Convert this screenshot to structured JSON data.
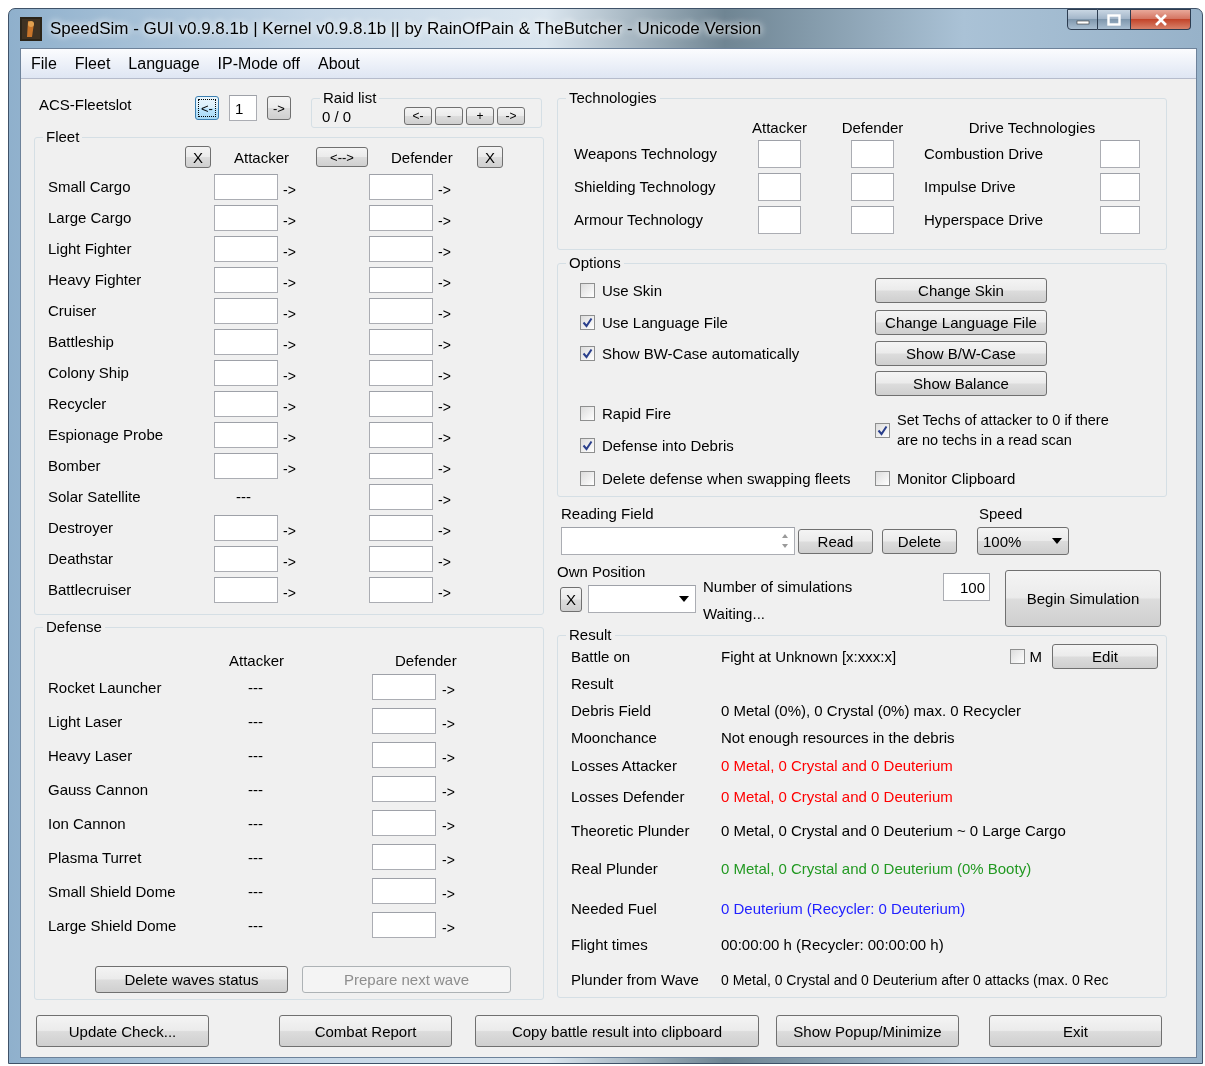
{
  "window": {
    "title": "SpeedSim - GUI v0.9.8.1b | Kernel v0.9.8.1b || by RainOfPain & TheButcher - Unicode Version"
  },
  "menu": [
    {
      "label": "File"
    },
    {
      "label": "Fleet"
    },
    {
      "label": "Language"
    },
    {
      "label": "IP-Mode off"
    },
    {
      "label": "About"
    }
  ],
  "acs_fleetslot": {
    "label": "ACS-Fleetslot",
    "prev": {
      "label": "<-",
      "focused": true
    },
    "value": "1",
    "next": {
      "label": "->",
      "focused": false
    }
  },
  "raid_list": {
    "title": "Raid list",
    "count": "0 / 0",
    "buttons": [
      "<-",
      "-",
      "+",
      "->"
    ]
  },
  "fleet": {
    "title": "Fleet",
    "clear_attacker": "X",
    "attacker": "Attacker",
    "swap": "<-->",
    "defender": "Defender",
    "clear_defender": "X",
    "ships": [
      {
        "name": "Small Cargo",
        "attacker_arrow": "->",
        "defender_arrow": "->"
      },
      {
        "name": "Large Cargo",
        "attacker_arrow": "->",
        "defender_arrow": "->"
      },
      {
        "name": "Light Fighter",
        "attacker_arrow": "->",
        "defender_arrow": "->"
      },
      {
        "name": "Heavy Fighter",
        "attacker_arrow": "->",
        "defender_arrow": "->"
      },
      {
        "name": "Cruiser",
        "attacker_arrow": "->",
        "defender_arrow": "->"
      },
      {
        "name": "Battleship",
        "attacker_arrow": "->",
        "defender_arrow": "->"
      },
      {
        "name": "Colony Ship",
        "attacker_arrow": "->",
        "defender_arrow": "->"
      },
      {
        "name": "Recycler",
        "attacker_arrow": "->",
        "defender_arrow": "->"
      },
      {
        "name": "Espionage Probe",
        "attacker_arrow": "->",
        "defender_arrow": "->"
      },
      {
        "name": "Bomber",
        "attacker_arrow": "->",
        "defender_arrow": "->"
      },
      {
        "name": "Solar Satellite",
        "attacker": "---",
        "defender_arrow": "->"
      },
      {
        "name": "Destroyer",
        "attacker_arrow": "->",
        "defender_arrow": "->"
      },
      {
        "name": "Deathstar",
        "attacker_arrow": "->",
        "defender_arrow": "->"
      },
      {
        "name": "Battlecruiser",
        "attacker_arrow": "->",
        "defender_arrow": "->"
      }
    ]
  },
  "defense": {
    "title": "Defense",
    "attacker": "Attacker",
    "defender": "Defender",
    "items": [
      {
        "name": "Rocket Launcher",
        "attacker": "---",
        "defender_arrow": "->"
      },
      {
        "name": "Light Laser",
        "attacker": "---",
        "defender_arrow": "->"
      },
      {
        "name": "Heavy Laser",
        "attacker": "---",
        "defender_arrow": "->"
      },
      {
        "name": "Gauss Cannon",
        "attacker": "---",
        "defender_arrow": "->"
      },
      {
        "name": "Ion Cannon",
        "attacker": "---",
        "defender_arrow": "->"
      },
      {
        "name": "Plasma Turret",
        "attacker": "---",
        "defender_arrow": "->"
      },
      {
        "name": "Small Shield Dome",
        "attacker": "---",
        "defender_arrow": "->"
      },
      {
        "name": "Large Shield Dome",
        "attacker": "---",
        "defender_arrow": "->"
      }
    ],
    "buttons": [
      {
        "label": "Delete waves status",
        "disabled": false
      },
      {
        "label": "Prepare next wave",
        "disabled": true
      }
    ]
  },
  "technologies": {
    "title": "Technologies",
    "attacker": "Attacker",
    "defender": "Defender",
    "drive_header": "Drive Technologies",
    "rows": [
      {
        "name": "Weapons Technology",
        "drive": "Combustion Drive"
      },
      {
        "name": "Shielding Technology",
        "drive": "Impulse Drive"
      },
      {
        "name": "Armour Technology",
        "drive": "Hyperspace Drive"
      }
    ]
  },
  "options": {
    "title": "Options",
    "items": [
      {
        "kind": "checkbox",
        "label": "Use Skin",
        "checked": false
      },
      {
        "kind": "button",
        "label": "Change Skin"
      },
      {
        "kind": "checkbox",
        "label": "Use Language File",
        "checked": true
      },
      {
        "kind": "button",
        "label": "Change Language File"
      },
      {
        "kind": "checkbox",
        "label": "Show BW-Case automatically",
        "checked": true
      },
      {
        "kind": "button",
        "label": "Show B/W-Case"
      },
      {
        "kind": "button",
        "label": "Show Balance"
      },
      {
        "kind": "checkbox",
        "label": "Rapid Fire",
        "checked": false
      },
      {
        "kind": "checkbox",
        "label": "Set Techs of attacker to 0 if there are no techs in a read scan",
        "checked": true
      },
      {
        "kind": "checkbox",
        "label": "Defense into Debris",
        "checked": true
      },
      {
        "kind": "checkbox",
        "label": "Delete defense when swapping fleets",
        "checked": false
      },
      {
        "kind": "checkbox",
        "label": "Monitor Clipboard",
        "checked": false
      }
    ]
  },
  "reading": {
    "label": "Reading Field",
    "read": "Read",
    "delete": "Delete",
    "speed_label": "Speed",
    "speed": "100%"
  },
  "simulation": {
    "own_position": "Own Position",
    "clear": "X",
    "count_label": "Number of simulations",
    "count": "100",
    "status": "Waiting...",
    "begin": "Begin Simulation"
  },
  "result": {
    "title": "Result",
    "marker": {
      "label": "M",
      "checked": false
    },
    "edit": "Edit",
    "rows": [
      {
        "label": "Battle on",
        "value": "Fight at Unknown [x:xxx:x]"
      },
      {
        "label": "Result"
      },
      {
        "label": "Debris Field",
        "value": "0 Metal (0%), 0 Crystal (0%) max. 0 Recycler"
      },
      {
        "label": "Moonchance",
        "value": "Not enough resources in the debris"
      },
      {
        "label": "Losses Attacker",
        "value": "0 Metal, 0 Crystal and 0 Deuterium",
        "color": "#ff0000"
      },
      {
        "label": "Losses Defender",
        "value": "0 Metal, 0 Crystal and 0 Deuterium",
        "color": "#ff0000"
      },
      {
        "label": "Theoretic Plunder",
        "value": "0 Metal, 0 Crystal and 0 Deuterium ~ 0 Large Cargo"
      },
      {
        "label": "Real Plunder",
        "value": "0 Metal, 0 Crystal and 0 Deuterium (0% Booty)",
        "color": "#229922"
      },
      {
        "label": "Needed Fuel",
        "value": "0 Deuterium (Recycler: 0 Deuterium)",
        "color": "#2222ff"
      },
      {
        "label": "Flight times",
        "value": "00:00:00 h (Recycler: 00:00:00 h)"
      },
      {
        "label": "Plunder from Wave",
        "value": "0 Metal, 0 Crystal and 0 Deuterium after 0 attacks (max. 0 Rec"
      }
    ]
  },
  "footer_buttons": [
    "Update Check...",
    "Combat Report",
    "Copy battle result into clipboard",
    "Show Popup/Minimize",
    "Exit"
  ]
}
